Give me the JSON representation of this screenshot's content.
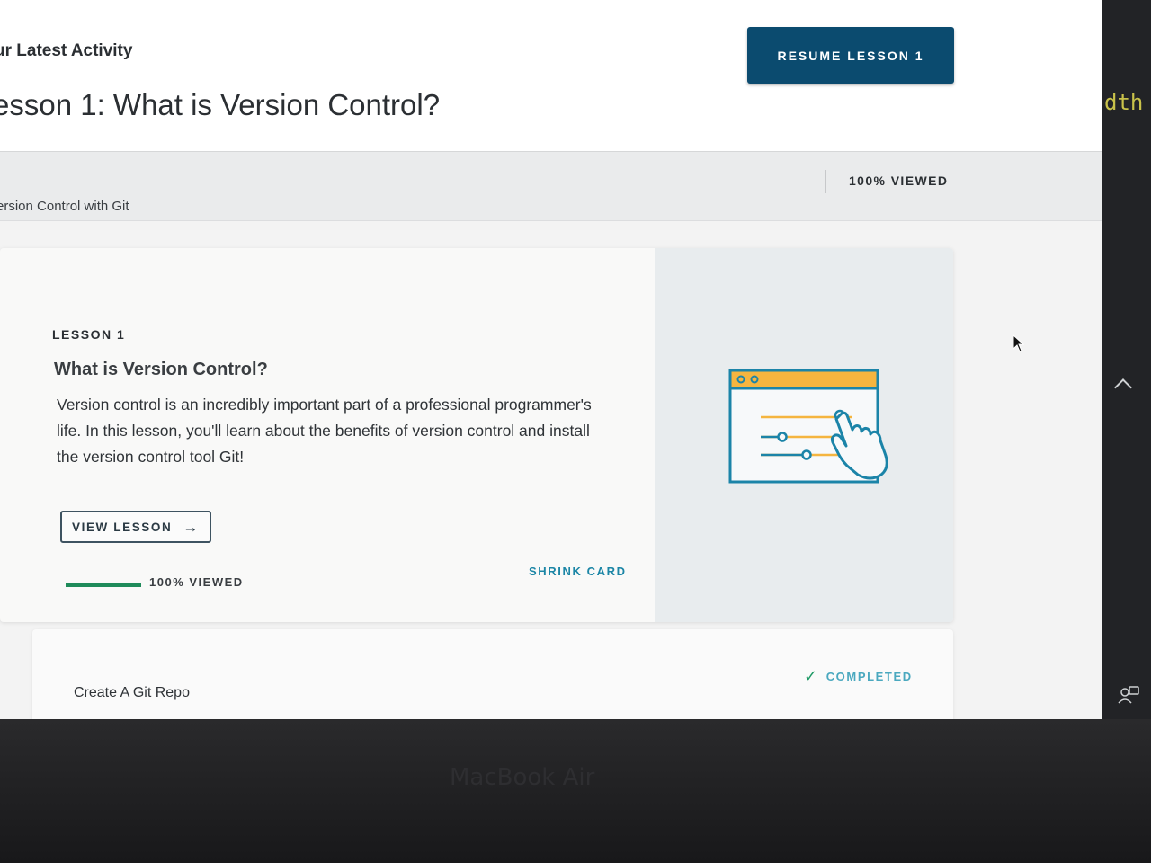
{
  "header": {
    "activity_label": "ur Latest Activity",
    "lesson_title": "esson 1: What is Version Control?",
    "resume_button": "RESUME LESSON 1"
  },
  "breadcrumb": {
    "course": "ersion Control with Git",
    "viewed_status": "100% VIEWED"
  },
  "lesson_card": {
    "eyebrow": "LESSON 1",
    "heading": "What is Version Control?",
    "description": "Version control is an incredibly important part of a professional programmer's life. In this lesson, you'll learn about the benefits of version control and install the version control tool Git!",
    "view_button": "VIEW LESSON",
    "arrow_icon": "→",
    "progress_fraction": 1.0,
    "progress_label": "100% VIEWED",
    "shrink_label": "SHRINK CARD",
    "illustration_icon": "browser-sliders-hand-icon"
  },
  "next_lesson": {
    "title": "Create A Git Repo",
    "status": "COMPLETED",
    "status_icon": "✓"
  },
  "side_panel": {
    "code_fragment": "dth"
  },
  "bezel": {
    "label": "MacBook Air"
  },
  "colors": {
    "primary_button": "#0b4b6f",
    "progress_green": "#1f8b5a",
    "link_teal": "#1c86a6",
    "illustration_orange": "#f5b53f",
    "illustration_blue": "#1b84a8"
  }
}
